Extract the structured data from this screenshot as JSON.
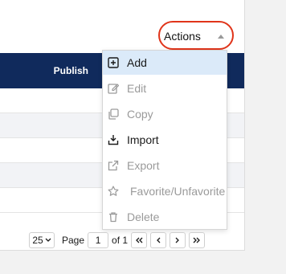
{
  "table": {
    "column_publish": "Publish"
  },
  "actions": {
    "label": "Actions"
  },
  "menu": {
    "items": [
      {
        "label": "Add",
        "icon": "plus-square-icon",
        "state": "highlighted"
      },
      {
        "label": "Edit",
        "icon": "edit-icon",
        "state": "disabled"
      },
      {
        "label": "Copy",
        "icon": "copy-icon",
        "state": "disabled"
      },
      {
        "label": "Import",
        "icon": "import-icon",
        "state": "enabled"
      },
      {
        "label": "Export",
        "icon": "export-icon",
        "state": "disabled"
      },
      {
        "label": "Favorite/Unfavorite",
        "icon": "star-icon",
        "state": "disabled"
      },
      {
        "label": "Delete",
        "icon": "trash-icon",
        "state": "disabled"
      }
    ]
  },
  "pager": {
    "page_size": "25",
    "page_label": "Page",
    "page_value": "1",
    "of_label": "of 1"
  },
  "colors": {
    "header_bg": "#102a5c",
    "highlight_bg": "#dbeaf9",
    "focus_ring": "#e0341a",
    "disabled_text": "#9a9a9a"
  }
}
